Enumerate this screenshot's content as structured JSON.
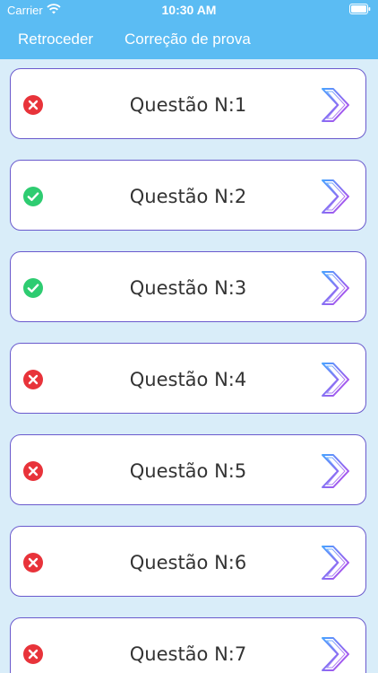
{
  "status_bar": {
    "carrier": "Carrier",
    "time": "10:30 AM"
  },
  "nav": {
    "back_label": "Retroceder",
    "title": "Correção de prova"
  },
  "colors": {
    "header": "#5bbcf3",
    "background": "#d9edf9",
    "wrong": "#e8333a",
    "correct": "#2ecc71",
    "row_border": "#6a5acd"
  },
  "questions": [
    {
      "label": "Questão N:1",
      "status": "wrong",
      "icon": "x-circle-icon"
    },
    {
      "label": "Questão N:2",
      "status": "correct",
      "icon": "check-circle-icon"
    },
    {
      "label": "Questão N:3",
      "status": "correct",
      "icon": "check-circle-icon"
    },
    {
      "label": "Questão N:4",
      "status": "wrong",
      "icon": "x-circle-icon"
    },
    {
      "label": "Questão N:5",
      "status": "wrong",
      "icon": "x-circle-icon"
    },
    {
      "label": "Questão N:6",
      "status": "wrong",
      "icon": "x-circle-icon"
    },
    {
      "label": "Questão N:7",
      "status": "wrong",
      "icon": "x-circle-icon"
    }
  ]
}
